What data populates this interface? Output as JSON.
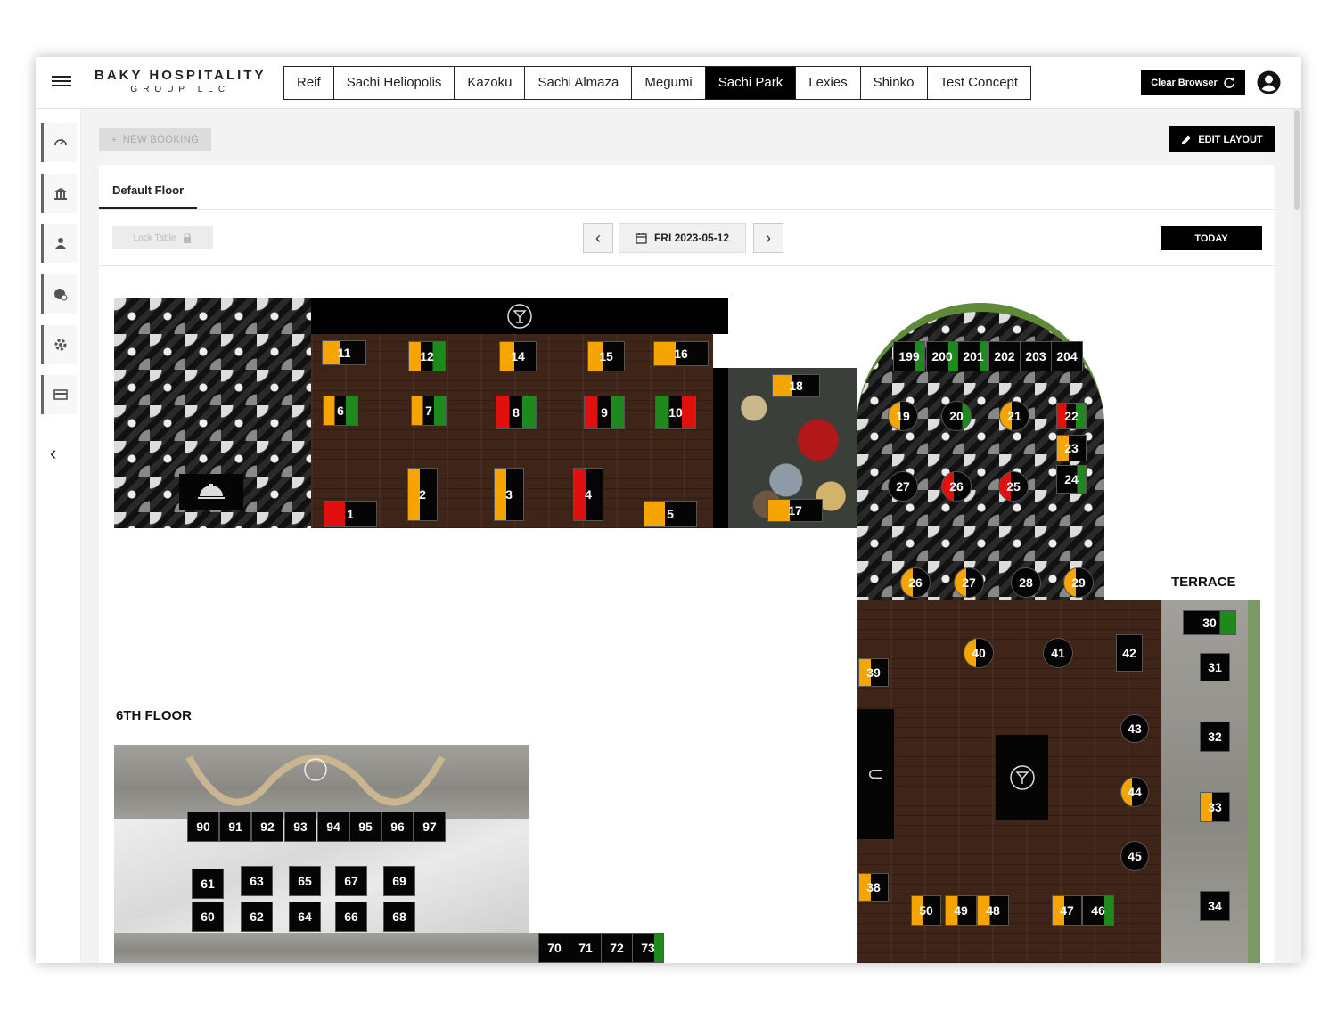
{
  "app": {
    "logo_line1": "BAKY HOSPITALITY",
    "logo_line2": "GROUP LLC"
  },
  "topbar": {
    "venue_tabs": [
      "Reif",
      "Sachi Heliopolis",
      "Kazoku",
      "Sachi Almaza",
      "Megumi",
      "Sachi Park",
      "Lexies",
      "Shinko",
      "Test Concept"
    ],
    "active_tab": "Sachi Park",
    "clear_browser_label": "Clear Browser"
  },
  "sidebar": {
    "items": [
      "dashboard-icon",
      "bank-icon",
      "person-icon",
      "guest-icon",
      "gear-icon",
      "card-icon"
    ]
  },
  "toolbar": {
    "new_booking_label": "NEW BOOKING",
    "edit_layout_label": "EDIT LAYOUT"
  },
  "floor_tabs": [
    "Default Floor"
  ],
  "controls": {
    "lock_table_label": "Lock Table",
    "date_label": "FRI 2023-05-12",
    "today_label": "TODAY"
  },
  "sections": {
    "terrace": "TERRACE",
    "sixth_floor": "6TH FLOOR"
  },
  "status_colors": {
    "orange": "#f5a400",
    "green": "#1e8a1e",
    "red": "#e20f0f"
  },
  "tables": [
    {
      "id": "11",
      "status": "orange"
    },
    {
      "id": "12",
      "status": "orange-green"
    },
    {
      "id": "14",
      "status": "orange"
    },
    {
      "id": "15",
      "status": "orange"
    },
    {
      "id": "16",
      "status": "orange"
    },
    {
      "id": "6",
      "status": "orange-green"
    },
    {
      "id": "7",
      "status": "orange-green"
    },
    {
      "id": "8",
      "status": "red-green"
    },
    {
      "id": "9",
      "status": "red-green"
    },
    {
      "id": "10",
      "status": "green-red"
    },
    {
      "id": "1",
      "status": "red"
    },
    {
      "id": "2",
      "status": "orange"
    },
    {
      "id": "3",
      "status": "orange"
    },
    {
      "id": "4",
      "status": "red"
    },
    {
      "id": "5",
      "status": "orange"
    },
    {
      "id": "18",
      "status": "orange"
    },
    {
      "id": "17",
      "status": "orange"
    },
    {
      "id": "199",
      "status": "green"
    },
    {
      "id": "200",
      "status": "green"
    },
    {
      "id": "201",
      "status": "green"
    },
    {
      "id": "202",
      "status": "free"
    },
    {
      "id": "203",
      "status": "free"
    },
    {
      "id": "204",
      "status": "free"
    },
    {
      "id": "19",
      "status": "orange"
    },
    {
      "id": "20",
      "status": "green"
    },
    {
      "id": "21",
      "status": "orange"
    },
    {
      "id": "22",
      "status": "red-green"
    },
    {
      "id": "23",
      "status": "orange"
    },
    {
      "id": "24",
      "status": "green"
    },
    {
      "id": "27",
      "status": "free"
    },
    {
      "id": "26",
      "status": "red"
    },
    {
      "id": "25",
      "status": "red"
    },
    {
      "id": "26",
      "status": "orange"
    },
    {
      "id": "27",
      "status": "orange"
    },
    {
      "id": "28",
      "status": "free"
    },
    {
      "id": "29",
      "status": "orange"
    },
    {
      "id": "30",
      "status": "green"
    },
    {
      "id": "31",
      "status": "free"
    },
    {
      "id": "32",
      "status": "free"
    },
    {
      "id": "33",
      "status": "orange"
    },
    {
      "id": "34",
      "status": "free"
    },
    {
      "id": "39",
      "status": "orange"
    },
    {
      "id": "40",
      "status": "orange"
    },
    {
      "id": "41",
      "status": "free"
    },
    {
      "id": "42",
      "status": "free"
    },
    {
      "id": "43",
      "status": "free"
    },
    {
      "id": "44",
      "status": "orange"
    },
    {
      "id": "45",
      "status": "free"
    },
    {
      "id": "38",
      "status": "orange"
    },
    {
      "id": "50",
      "status": "orange"
    },
    {
      "id": "49",
      "status": "orange"
    },
    {
      "id": "48",
      "status": "orange"
    },
    {
      "id": "47",
      "status": "orange"
    },
    {
      "id": "46",
      "status": "green"
    },
    {
      "id": "90",
      "status": "free"
    },
    {
      "id": "91",
      "status": "free"
    },
    {
      "id": "92",
      "status": "free"
    },
    {
      "id": "93",
      "status": "free"
    },
    {
      "id": "94",
      "status": "free"
    },
    {
      "id": "95",
      "status": "free"
    },
    {
      "id": "96",
      "status": "free"
    },
    {
      "id": "97",
      "status": "free"
    },
    {
      "id": "61",
      "status": "free"
    },
    {
      "id": "63",
      "status": "free"
    },
    {
      "id": "65",
      "status": "free"
    },
    {
      "id": "67",
      "status": "free"
    },
    {
      "id": "69",
      "status": "free"
    },
    {
      "id": "60",
      "status": "free"
    },
    {
      "id": "62",
      "status": "free"
    },
    {
      "id": "64",
      "status": "free"
    },
    {
      "id": "66",
      "status": "free"
    },
    {
      "id": "68",
      "status": "free"
    },
    {
      "id": "70",
      "status": "free"
    },
    {
      "id": "71",
      "status": "free"
    },
    {
      "id": "72",
      "status": "free"
    },
    {
      "id": "73",
      "status": "green"
    }
  ]
}
